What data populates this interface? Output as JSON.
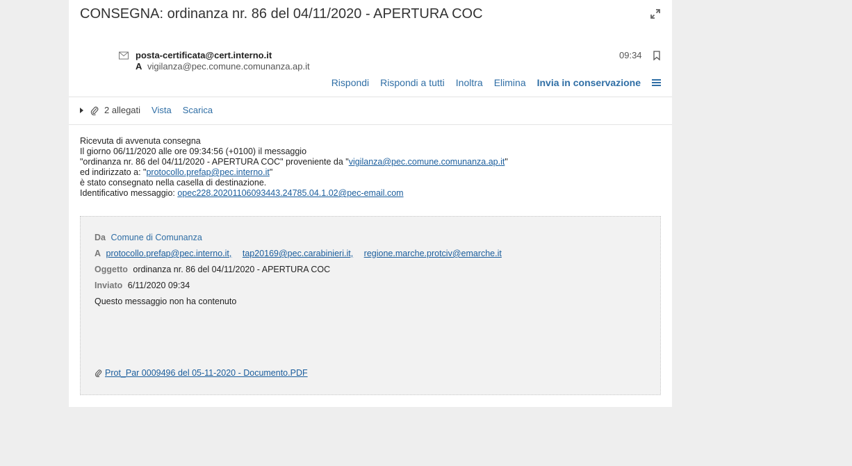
{
  "message": {
    "subject": "CONSEGNA: ordinanza nr. 86 del 04/11/2020 - APERTURA COC",
    "from": "posta-certificata@cert.interno.it",
    "to_label": "A",
    "to": "vigilanza@pec.comune.comunanza.ap.it",
    "time": "09:34"
  },
  "actions": {
    "reply": "Rispondi",
    "reply_all": "Rispondi a tutti",
    "forward": "Inoltra",
    "delete": "Elimina",
    "archive": "Invia in conservazione"
  },
  "attachments": {
    "count_label": "2 allegati",
    "view": "Vista",
    "download": "Scarica"
  },
  "body": {
    "line1": "Ricevuta di avvenuta consegna",
    "line2": "Il giorno 06/11/2020 alle ore 09:34:56 (+0100) il messaggio",
    "line3_pre": "\"ordinanza nr. 86 del 04/11/2020 - APERTURA COC\" proveniente da \"",
    "line3_link": "vigilanza@pec.comune.comunanza.ap.it",
    "line3_post": "\"",
    "line4_pre": "ed indirizzato a: \"",
    "line4_link": "protocollo.prefap@pec.interno.it",
    "line4_post": "\"",
    "line5": "è stato consegnato nella casella di destinazione.",
    "line6_pre": "Identificativo messaggio: ",
    "line6_link": "opec228.20201106093443.24785.04.1.02@pec-email.com"
  },
  "quoted": {
    "from_label": "Da",
    "from": "Comune di Comunanza",
    "to_label": "A",
    "recipients": [
      "protocollo.prefap@pec.interno.it,",
      "tap20169@pec.carabinieri.it,",
      "regione.marche.protciv@emarche.it"
    ],
    "subject_label": "Oggetto",
    "subject": "ordinanza nr. 86 del 04/11/2020 - APERTURA COC",
    "sent_label": "Inviato",
    "sent": "6/11/2020 09:34",
    "no_content": "Questo messaggio non ha contenuto",
    "file": "Prot_Par 0009496 del 05-11-2020 - Documento.PDF"
  },
  "icons": {
    "expand": "expand-icon",
    "envelope": "envelope-icon",
    "bookmark": "bookmark-icon",
    "menu": "hamburger-menu-icon",
    "paperclip": "paperclip-icon"
  },
  "colors": {
    "link": "#2f6ea5",
    "background": "#eeeeee",
    "quoted_bg": "#f2f2f2"
  }
}
